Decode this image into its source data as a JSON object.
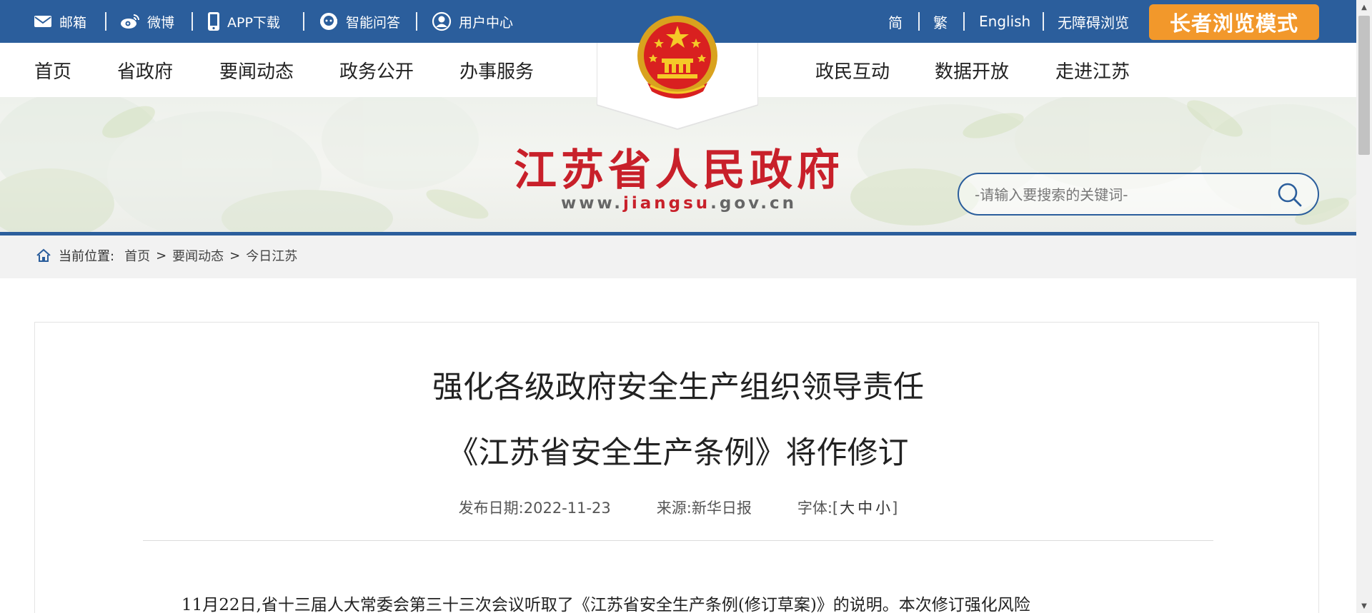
{
  "topbar": {
    "links": [
      {
        "label": "邮箱",
        "icon": "mail-icon"
      },
      {
        "label": "微博",
        "icon": "weibo-icon"
      },
      {
        "label": "APP下载",
        "icon": "phone-icon"
      },
      {
        "label": "智能问答",
        "icon": "chat-bot-icon"
      },
      {
        "label": "用户中心",
        "icon": "user-icon"
      }
    ],
    "right_links": [
      "简",
      "繁",
      "English",
      "无障碍浏览"
    ],
    "elder_mode": "长者浏览模式"
  },
  "nav": {
    "left": [
      "首页",
      "省政府",
      "要闻动态",
      "政务公开",
      "办事服务"
    ],
    "right": [
      "政民互动",
      "数据开放",
      "走进江苏"
    ]
  },
  "banner": {
    "site_name": "江苏省人民政府",
    "domain_prefix": "www.",
    "domain_highlight": "jiangsu",
    "domain_suffix": ".gov.cn",
    "search_placeholder": "-请输入要搜索的关键词-"
  },
  "breadcrumb": {
    "label": "当前位置:",
    "items": [
      "首页",
      "要闻动态",
      "今日江苏"
    ]
  },
  "article": {
    "title_line1": "强化各级政府安全生产组织领导责任",
    "title_line2": "《江苏省安全生产条例》将作修订",
    "date_label": "发布日期:2022-11-23",
    "source_label": "来源:新华日报",
    "font_label": "字体:[",
    "font_sizes": [
      "大",
      "中",
      "小"
    ],
    "font_close": "]",
    "paragraph1": "11月22日,省十三届人大常委会第三十三次会议听取了《江苏省安全生产条例(修订草案)》的说明。本次修订强化风险"
  },
  "colors": {
    "primary_blue": "#2b5e9c",
    "title_red": "#c8202a",
    "elder_orange": "#f2982b"
  }
}
